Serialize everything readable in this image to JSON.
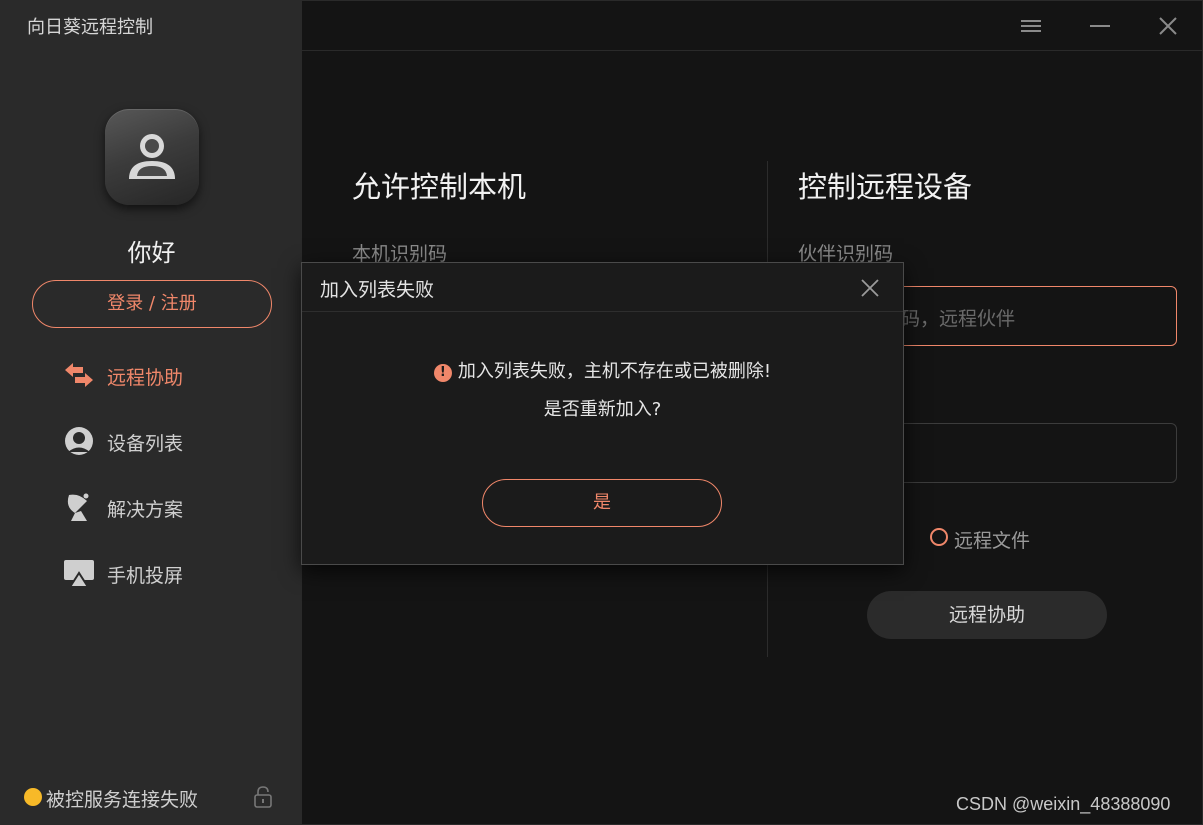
{
  "app": {
    "title": "向日葵远程控制"
  },
  "sidebar": {
    "greeting": "你好",
    "login_label": "登录 / 注册",
    "items": [
      {
        "label": "远程协助",
        "icon": "swap-arrows-icon",
        "active": true
      },
      {
        "label": "设备列表",
        "icon": "device-list-icon",
        "active": false
      },
      {
        "label": "解决方案",
        "icon": "satellite-dish-icon",
        "active": false
      },
      {
        "label": "手机投屏",
        "icon": "screen-cast-icon",
        "active": false
      }
    ],
    "status_text": "被控服务连接失败",
    "status_color": "#f7b928"
  },
  "main": {
    "allow_title": "允许控制本机",
    "local_id_label": "本机识别码",
    "control_title": "控制远程设备",
    "partner_id_label": "伙伴识别码",
    "partner_placeholder_visible": "码，远程伙伴",
    "remote_file_label": "远程文件",
    "connect_label": "远程协助"
  },
  "dialog": {
    "title": "加入列表失败",
    "message": "加入列表失败，主机不存在或已被删除!",
    "question": "是否重新加入?",
    "confirm_label": "是"
  },
  "watermark": "CSDN @weixin_48388090",
  "colors": {
    "accent": "#f0876a",
    "sidebar_bg": "#2a2a2a",
    "main_bg": "#141414"
  }
}
